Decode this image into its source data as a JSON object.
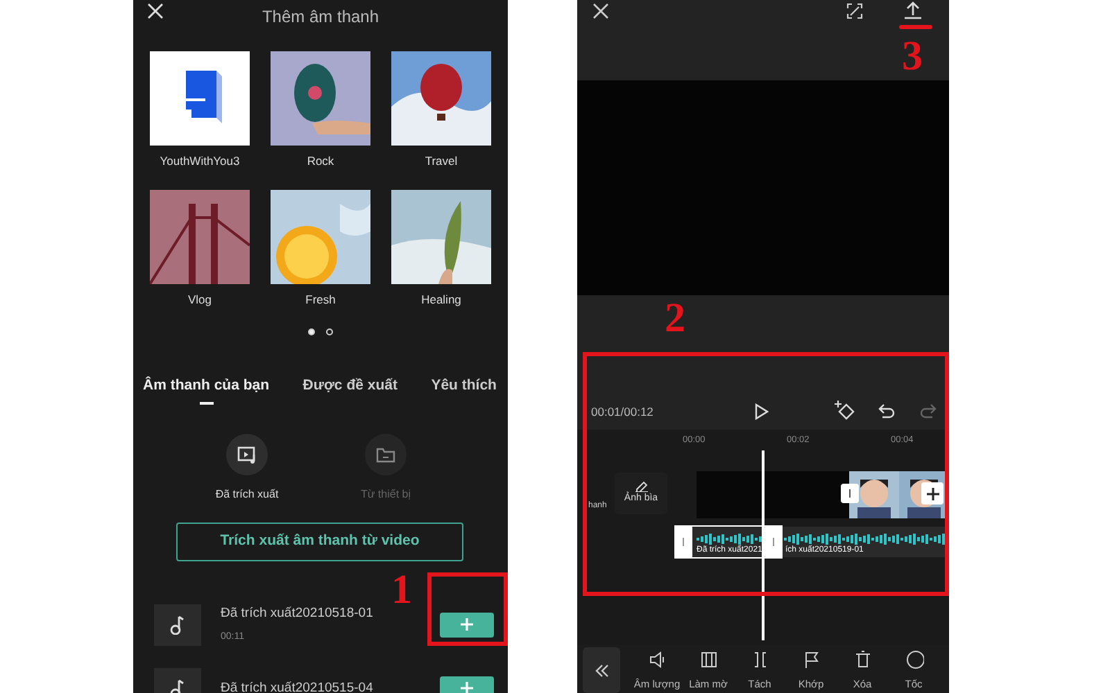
{
  "left_screen": {
    "title": "Thêm âm thanh",
    "playlists": [
      {
        "name": "YouthWithYou3",
        "kind": "picture"
      },
      {
        "name": "Rock",
        "kind": "picture"
      },
      {
        "name": "Travel",
        "kind": "picture"
      },
      {
        "name": "Vlog",
        "kind": "picture"
      },
      {
        "name": "Fresh",
        "kind": "picture"
      },
      {
        "name": "Healing",
        "kind": "picture"
      }
    ],
    "pager": [
      {
        "selected": true
      },
      {
        "selected": false
      }
    ],
    "tabs": [
      {
        "label": "Âm thanh của bạn",
        "selected": true
      },
      {
        "label": "Được đề xuất",
        "selected": false
      },
      {
        "label": "Yêu thích",
        "selected": false
      }
    ],
    "sources": [
      {
        "label": "Đã trích xuất",
        "kind": "extracted",
        "disabled": false
      },
      {
        "label": "Từ thiết bị",
        "kind": "folder",
        "disabled": true
      }
    ],
    "extract_button": "Trích xuất âm thanh từ video",
    "tracks": [
      {
        "title": "Đã trích xuất20210518-01",
        "duration": "00:11"
      },
      {
        "title": "Đã trích xuất20210515-04"
      }
    ]
  },
  "right_screen": {
    "time": "00:01/00:12",
    "ruler": [
      "00:00",
      "00:02",
      "00:04"
    ],
    "side_label": "hanh",
    "cover_label": "Ảnh bìa",
    "audio_clips": [
      "Đã trích xuất2021",
      "ích xuất20210519-01"
    ],
    "toolbar": [
      {
        "label": "Âm lượng",
        "kind": "volume"
      },
      {
        "label": "Làm mờ",
        "kind": "blur"
      },
      {
        "label": "Tách",
        "kind": "split"
      },
      {
        "label": "Khớp",
        "kind": "flag"
      },
      {
        "label": "Xóa",
        "kind": "delete"
      },
      {
        "label": "Tốc",
        "kind": "speed"
      }
    ]
  },
  "annotations": [
    {
      "label": "1"
    },
    {
      "label": "2"
    },
    {
      "label": "3"
    }
  ]
}
